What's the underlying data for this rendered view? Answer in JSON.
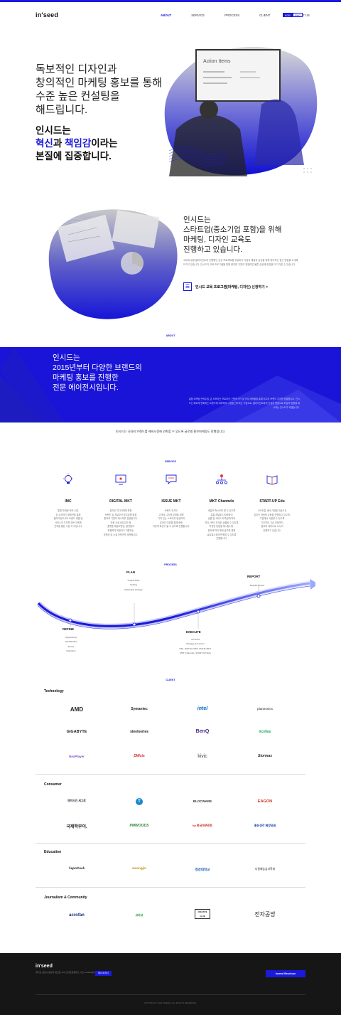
{
  "header": {
    "logo": "in'seed",
    "nav": [
      "ABOUT",
      "SERVICE",
      "PROCESS",
      "CLIENT",
      "CONTACT US"
    ],
    "lang": [
      "KOR",
      "ENG"
    ]
  },
  "hero": {
    "lines": [
      "독보적인 디자인과",
      "창의적인 마케팅 홍보를 통해",
      "수준 높은 컨설팅을",
      "해드립니다."
    ],
    "bold1": "인시드는",
    "bold2a": "혁신",
    "bold2b": "과 ",
    "bold2c": "책임감",
    "bold2d": "이라는",
    "bold3": "본질에 집중합니다.",
    "board_text": "Action Items"
  },
  "edu": {
    "lines": [
      "인시드는",
      "스타트업(중소기업 포함)을 위해",
      "마케팅, 디자인 교육도",
      "진행하고 있습니다."
    ],
    "small": "국내외 유명 클라이언트와 진행했던 성공 프로젝트를 공유하고 기업의 매출과 성공을 위해 창의적인 접근 방법을 소개해드리고 있습니다. 인시드의 교육 프로그램을 통해 한다면 기업의 경쟁력은 물론 성공에 한걸음 더 다가갈 수 있습니다.",
    "link": "인시드 교육 프로그램(마케팅, 디자인) 신청하기 >"
  },
  "about": {
    "tag": "ABOUT",
    "lines": [
      "인시드는",
      "2015년부터 다양한 브랜드의",
      "마케팅 홍보를 진행한",
      "전문 에이전시입니다."
    ],
    "small": "홍함 마케팅 전략수립, 온 오프라인 프로모션, 컨텐츠 PR 및 기타 제작물을 통해 최고의 브랜드 가치를 창출합니다. 인시드는 빠르게 변화하는 트렌드에 대처하며 시장을 선도하는 기업으로, 클라이언트와의 긴밀한 협업으로 최상의 방향을 제시하는 인시드가 되겠습니다.",
    "caption": "인시드는 국내외 브랜드를 해외시장에 안착할 수 있도록 글로벌 홍보마케팅도 진행합니다."
  },
  "service": {
    "tag": "SERVICE",
    "items": [
      {
        "name": "IMC",
        "desc": "통합 마케팅 전략 수립,\n온 오프라인 매체만을 통해\n클라이언트사의 브랜드 제품 및\n서비스의 가치를 모든 이에게\n전략을 통한 시장 속 도입니다."
      },
      {
        "name": "DIGITAL MKT",
        "desc": "온라인 미디어매체 활용\n브랜드 및 프로모션 광고집행 등을\n통하여 기업의 메시지를 전달합니다.\n또한 소셜 네트워크 등\n플랫폼 채널브랜딩, 플랫폼의\n활용하여 목표하고 지향하는\n방향성 및 소셜 컨텐츠를 제작합니다."
      },
      {
        "name": "ISSUE MKT",
        "desc": "브랜드 인지도\n고객의 니즈에 부합을 위해\n가치 있는 스토리를 생성하여\n온라인 여론을 통해 화제\n이렇게 확산이 될 수 있도록 진행합니다."
      },
      {
        "name": "MKT Channels",
        "desc": "세일즈 측스토를 할 수 있도록\n유통 채널을 다각화하여\n상품 및 서비스의 특장에 따라\n여러, 전략, 단계로 상품을 수 있도록\n다양한 방법을 제시합니다.\n필요에 따라 해외 홍보를 통해\n글로벌시장에 판매할 수 있도록\n진행합니다."
      },
      {
        "name": "START-UP Edu",
        "desc": "스타트업, 중소기업을 대상으로\n온라인 마케팅 교육을 진행하고 있으며,\n기업에서 사용할 수 있도록\n기초부터 고급 과정까지\n필요와 세미나로 나누어\n진행하고 있습니다."
      }
    ]
  },
  "process": {
    "tag": "PROCESS",
    "plan": {
      "title": "PLAN",
      "subs": [
        "Project Plan",
        "Setting",
        "Marketing strategy"
      ]
    },
    "report": {
      "title": "REPORT",
      "subs": [
        "Results Report"
      ]
    },
    "define": {
      "title": "DEFINE",
      "subs": [
        "Opportunity",
        "Identification",
        "Scope",
        "Definition"
      ]
    },
    "execute": {
      "title": "EXECUTE",
      "subs": [
        "ACTION",
        "Manage & Control",
        "IMC, DIGITAL MKT, ISSUE MKT,",
        "MKT Channels, START-UP Edu"
      ]
    }
  },
  "client": {
    "tag": "CLIENT",
    "technology": {
      "label": "Technology",
      "logos": [
        "AMD",
        "Symantec",
        "intel",
        "plantronics",
        "GIGABYTE",
        "steelseries",
        "BenQ",
        "itcellay",
        "NexPlayer",
        "DWcts",
        "kivic",
        "Stormax"
      ]
    },
    "consumer": {
      "label": "Consumer",
      "logos": [
        "메이드인 세그로",
        "T",
        "BLOCWARE",
        "EAGON",
        "국제학부이.",
        "PMWOODS",
        "hy 한국야쿠르트",
        "좋은생각 혜양공원"
      ]
    },
    "education": {
      "label": "Education",
      "logos": [
        "Superbook",
        "woongjin",
        "청강대학교",
        "다원예능심리학회"
      ]
    },
    "journalism": {
      "label": "Journalism & Community",
      "logos": [
        "acrofan",
        "코바코",
        "CREATIVE CLUB",
        "전자공방"
      ]
    }
  },
  "footer": {
    "logo": "in'seed",
    "info": "경기도 성남시 분당구 판교로 123 스타트업캠퍼스 시드 contact@in-seed.com",
    "btn1": "회사소개서",
    "btn2": "Inseed Brochure",
    "copy": "COPYRIGHT 2019 INSEED. ALL RIGHTS RESERVED."
  },
  "colors": {
    "accent": "#1a1adc",
    "dark": "#161616"
  }
}
